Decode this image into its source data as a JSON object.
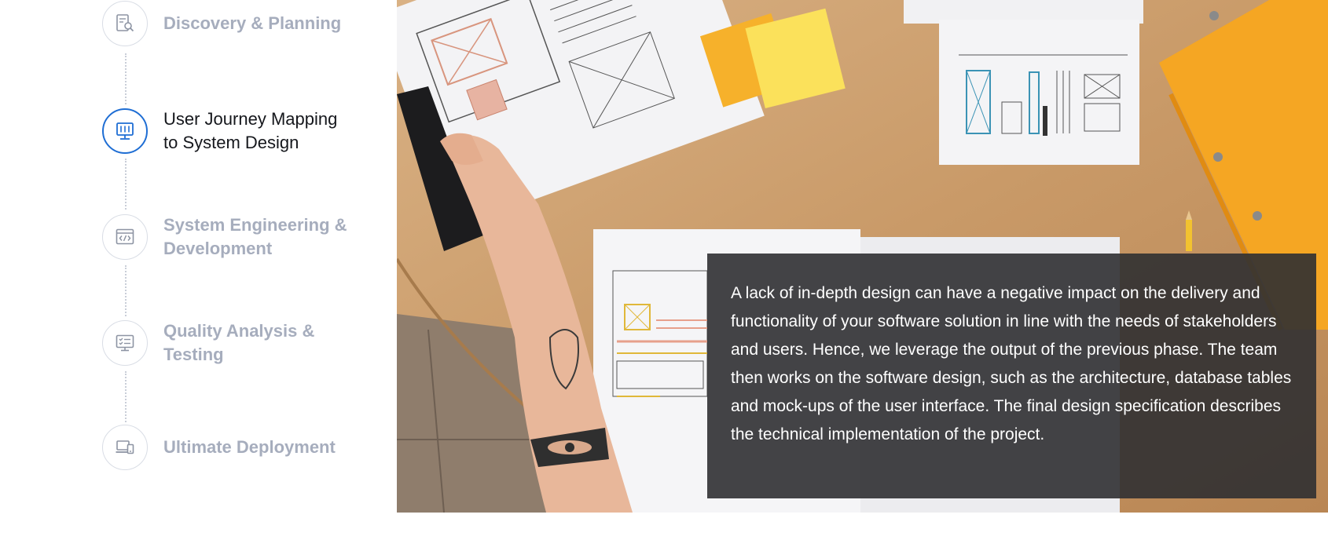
{
  "process": {
    "steps": [
      {
        "label": "Discovery & Planning",
        "icon": "search-document-icon",
        "active": false
      },
      {
        "label": "User Journey Mapping to System Design",
        "icon": "system-design-icon",
        "active": true
      },
      {
        "label": "System Engineering & Development",
        "icon": "code-window-icon",
        "active": false
      },
      {
        "label": "Quality Analysis & Testing",
        "icon": "monitor-checklist-icon",
        "active": false
      },
      {
        "label": "Ultimate Deployment",
        "icon": "devices-icon",
        "active": false
      }
    ]
  },
  "detail": {
    "description": "A lack of in-depth design can have a negative impact on the delivery and functionality of your software solution in line with the needs of stakeholders and users. Hence, we leverage the output of the previous phase. The team then works on the software design, such as the architecture, database tables and mock-ups of the user interface. The final design specification describes the technical implementation of the project."
  },
  "colors": {
    "accent": "#1f6ed4",
    "inactive_label": "#a6adbd",
    "active_label": "#15171c",
    "overlay_bg": "#303032"
  }
}
